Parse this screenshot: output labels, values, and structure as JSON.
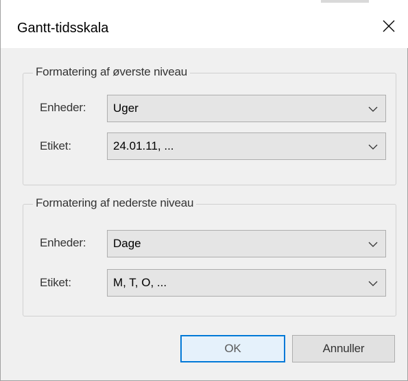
{
  "window": {
    "title": "Gantt-tidsskala",
    "close_icon": "close-icon"
  },
  "top_group": {
    "legend": "Formatering af øverste niveau",
    "units_label": "Enheder:",
    "units_value": "Uger",
    "label_label": "Etiket:",
    "label_value": "24.01.11, ..."
  },
  "bottom_group": {
    "legend": "Formatering af nederste niveau",
    "units_label": "Enheder:",
    "units_value": "Dage",
    "label_label": "Etiket:",
    "label_value": "M, T, O, ..."
  },
  "buttons": {
    "ok": "OK",
    "cancel": "Annuller"
  },
  "colors": {
    "default_button_border": "#0078d7",
    "default_button_fill": "#e5f1fb"
  }
}
